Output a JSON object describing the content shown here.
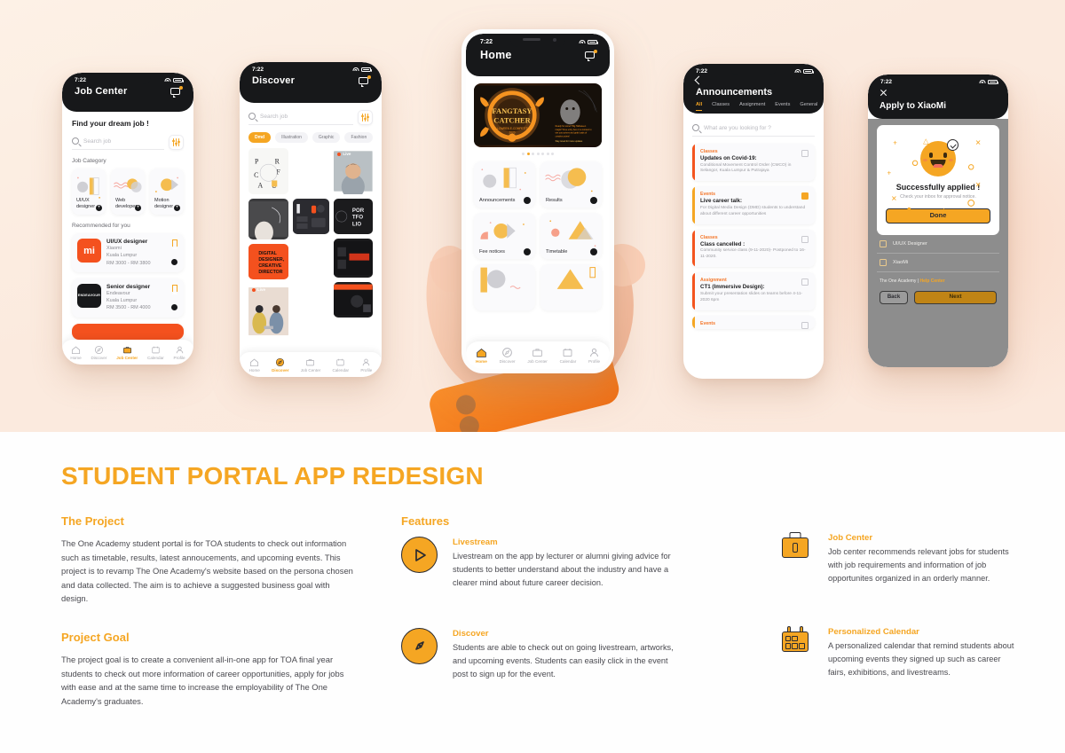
{
  "colors": {
    "accent": "#f5a623",
    "dark": "#17181a",
    "hero_bg": "#fbeade",
    "red": "#f4541e"
  },
  "hero": {
    "phone1": {
      "status_time": "7:22",
      "title": "Job Center",
      "heading": "Find your dream job !",
      "search_placeholder": "Search job",
      "category_label": "Job Category",
      "categories": [
        {
          "label": "UI/UX designer"
        },
        {
          "label": "Web developer"
        },
        {
          "label": "Motion designer"
        }
      ],
      "recommended_label": "Recommended for you",
      "jobs": [
        {
          "logo": "mi",
          "title": "UI/UX designer",
          "company": "Xiaomi",
          "location": "Kuala Lumpur",
          "salary": "RM 3000 - RM 3800"
        },
        {
          "logo": "ENDEAVOUR",
          "title": "Senior designer",
          "company": "Endeavour",
          "location": "Kuala Lumpur",
          "salary": "RM 3500 - RM 4000"
        }
      ],
      "tabs": [
        {
          "label": "Home",
          "active": false
        },
        {
          "label": "Discover",
          "active": false
        },
        {
          "label": "Job Center",
          "active": true
        },
        {
          "label": "Calendar",
          "active": false
        },
        {
          "label": "Profile",
          "active": false
        }
      ]
    },
    "phone2": {
      "status_time": "7:22",
      "title": "Discover",
      "search_placeholder": "Search job",
      "chips": [
        {
          "label": "Dmd",
          "active": true
        },
        {
          "label": "Illustration",
          "active": false
        },
        {
          "label": "Graphic",
          "active": false
        },
        {
          "label": "Fashion",
          "active": false
        }
      ],
      "live_label": "Live",
      "tiles": [
        {
          "caption": "DMD Live Career Talk"
        },
        {
          "caption": "DIGITAL DESIGNER, CREATIVE DIRECTOR"
        },
        {
          "caption": "PORTFOLIO"
        }
      ],
      "tabs": [
        {
          "label": "Home",
          "active": false
        },
        {
          "label": "Discover",
          "active": true
        },
        {
          "label": "Job Center",
          "active": false
        },
        {
          "label": "Calendar",
          "active": false
        },
        {
          "label": "Profile",
          "active": false
        }
      ]
    },
    "phone3": {
      "status_time": "7:22",
      "title": "Home",
      "banner": {
        "title": "FANGTASY CATCHER",
        "subtitle": "HALLOWEEN E-COMPETITION",
        "year": "2020"
      },
      "carousel_dots": 7,
      "carousel_active": 1,
      "grid": [
        {
          "label": "Announcements"
        },
        {
          "label": "Results"
        },
        {
          "label": "Fee notices"
        },
        {
          "label": "Timetable"
        }
      ],
      "tabs": [
        {
          "label": "Home",
          "active": true
        },
        {
          "label": "Discover",
          "active": false
        },
        {
          "label": "Job Center",
          "active": false
        },
        {
          "label": "Calendar",
          "active": false
        },
        {
          "label": "Profile",
          "active": false
        }
      ]
    },
    "phone4": {
      "status_time": "7:22",
      "title": "Announcements",
      "tabs": [
        {
          "label": "All",
          "active": true
        },
        {
          "label": "Classes",
          "active": false
        },
        {
          "label": "Assignment",
          "active": false
        },
        {
          "label": "Events",
          "active": false
        },
        {
          "label": "General",
          "active": false
        }
      ],
      "search_placeholder": "What are you looking for ?",
      "announcements": [
        {
          "category": "Classes",
          "title": "Updates on Covid-19:",
          "desc": "Conditional Movement Control Order (CMCO) in Selangor, Kuala Lumpur & Putrajaya",
          "kind": "classes",
          "icon_filled": false
        },
        {
          "category": "Events",
          "title": "Live career talk:",
          "desc": "For Digital Media Design (DMD) students to understand about different career opportunities",
          "kind": "events",
          "icon_filled": true
        },
        {
          "category": "Classes",
          "title": "Class cancelled :",
          "desc": "Community service class (9-11-2020)- Postponed to 16-11-2020.",
          "kind": "classes",
          "icon_filled": false
        },
        {
          "category": "Assignment",
          "title": "CT1 (Immersive Design):",
          "desc": "Submit your presentation slides on teams before 4-11-2020 6pm",
          "kind": "assign",
          "icon_filled": false
        },
        {
          "category": "Events",
          "title": "",
          "desc": "",
          "kind": "events",
          "icon_filled": false
        }
      ]
    },
    "phone5": {
      "status_time": "7:22",
      "title": "Apply to XiaoMi",
      "success_title": "Successfully applied !",
      "success_sub": "Check your inbox for approval notice.",
      "done_label": "Done",
      "fields": [
        {
          "label": "UI/UX Designer"
        },
        {
          "label": "XiaoMi"
        }
      ],
      "help_prefix": "The One Academy | ",
      "help_link": "Help Center",
      "back_label": "Back",
      "next_label": "Next"
    }
  },
  "content": {
    "title": "STUDENT PORTAL APP REDESIGN",
    "project": {
      "heading": "The Project",
      "body": "The One Academy student portal is for TOA students to check out information such as timetable, results, latest annoucements, and upcoming events. This project is to revamp The One Academy's website based on the persona chosen and data collected. The aim is to achieve a suggested business goal with design."
    },
    "goal": {
      "heading": "Project Goal",
      "body": "The project goal is to create a convenient all-in-one app for TOA final year students to check out more information of career opportunities, apply for jobs with ease and at the same time to increase the employability of The One Academy's graduates."
    },
    "features": {
      "heading": "Features",
      "items": [
        {
          "icon": "play-icon",
          "title": "Livestream",
          "body": "Livestream on the app by lecturer or alumni giving advice for students to better understand about the industry and have a clearer mind about future career decision."
        },
        {
          "icon": "compass-icon",
          "title": "Discover",
          "body": "Students are able to check out on going livestream, artworks, and upcoming events. Students can easily click in the event post to sign up for the event."
        },
        {
          "icon": "briefcase-icon",
          "title": "Job Center",
          "body": "Job center recommends relevant jobs for students with job requirements and information of job opportunites organized in an orderly manner."
        },
        {
          "icon": "calendar-icon",
          "title": "Personalized Calendar",
          "body": "A personalized calendar that remind students about upcoming events they signed up such as career fairs, exhibitions, and livestreams."
        }
      ]
    }
  }
}
